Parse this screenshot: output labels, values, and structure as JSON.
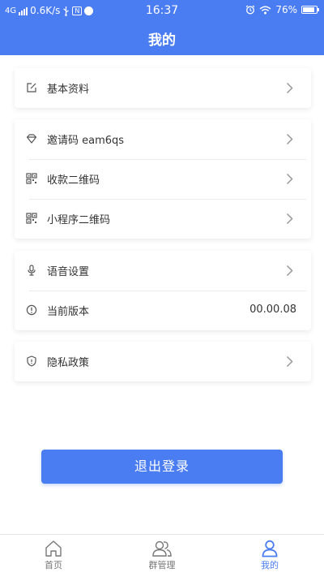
{
  "status_bar": {
    "network": "4G",
    "speed": "0.6K/s",
    "nfc": "N",
    "time": "16:37",
    "battery": "76%"
  },
  "header": {
    "title": "我的"
  },
  "menu": {
    "profile": {
      "label": "基本资料",
      "icon": "edit-icon"
    },
    "invite": {
      "label": "邀请码 eam6qs",
      "icon": "diamond-icon"
    },
    "payment_qr": {
      "label": "收款二维码",
      "icon": "qrcode-icon"
    },
    "miniprogram_qr": {
      "label": "小程序二维码",
      "icon": "qrcode-icon"
    },
    "voice": {
      "label": "语音设置",
      "icon": "microphone-icon"
    },
    "version": {
      "label": "当前版本",
      "value": "00.00.08",
      "icon": "info-icon"
    },
    "privacy": {
      "label": "隐私政策",
      "icon": "shield-icon"
    }
  },
  "logout_label": "退出登录",
  "tabbar": {
    "home": "首页",
    "groups": "群管理",
    "mine": "我的"
  },
  "colors": {
    "accent": "#4a7cf2",
    "icon": "#555555",
    "chevron": "#999999"
  }
}
